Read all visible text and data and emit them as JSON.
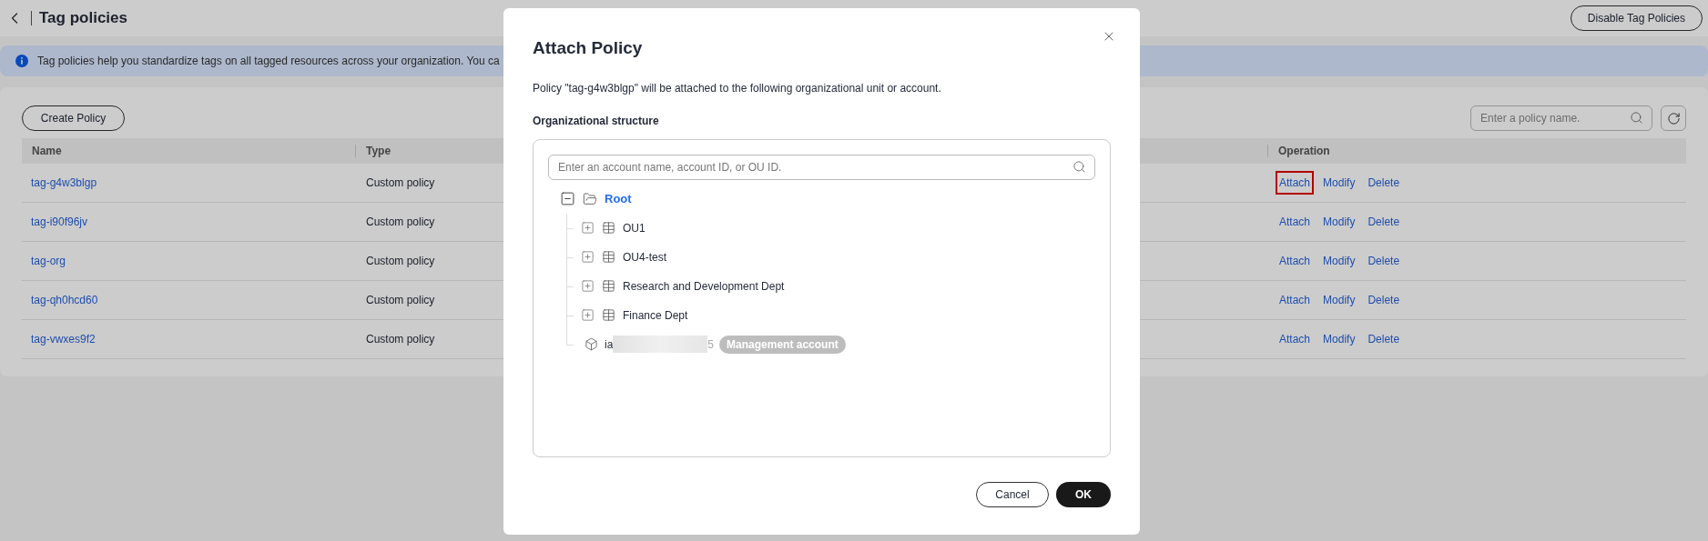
{
  "header": {
    "title": "Tag policies",
    "action": "Disable Tag Policies"
  },
  "banner": {
    "text": "Tag policies help you standardize tags on all tagged resources across your organization. You ca"
  },
  "toolbar": {
    "create": "Create Policy",
    "search": {
      "placeholder": "Enter a policy name."
    }
  },
  "table": {
    "columns": [
      "Name",
      "Type",
      "Operation"
    ],
    "rows": [
      {
        "name": "tag-g4w3blgp",
        "type": "Custom policy",
        "operations": [
          {
            "label": "Attach",
            "highlighted": true
          },
          {
            "label": "Modify",
            "highlighted": false
          },
          {
            "label": "Delete",
            "highlighted": false
          }
        ]
      },
      {
        "name": "tag-i90f96jv",
        "type": "Custom policy",
        "operations": [
          {
            "label": "Attach",
            "highlighted": false
          },
          {
            "label": "Modify",
            "highlighted": false
          },
          {
            "label": "Delete",
            "highlighted": false
          }
        ]
      },
      {
        "name": "tag-org",
        "type": "Custom policy",
        "operations": [
          {
            "label": "Attach",
            "highlighted": false
          },
          {
            "label": "Modify",
            "highlighted": false
          },
          {
            "label": "Delete",
            "highlighted": false
          }
        ]
      },
      {
        "name": "tag-qh0hcd60",
        "type": "Custom policy",
        "operations": [
          {
            "label": "Attach",
            "highlighted": false
          },
          {
            "label": "Modify",
            "highlighted": false
          },
          {
            "label": "Delete",
            "highlighted": false
          }
        ]
      },
      {
        "name": "tag-vwxes9f2",
        "type": "Custom policy",
        "operations": [
          {
            "label": "Attach",
            "highlighted": false
          },
          {
            "label": "Modify",
            "highlighted": false
          },
          {
            "label": "Delete",
            "highlighted": false
          }
        ]
      }
    ]
  },
  "dialog": {
    "title": "Attach Policy",
    "description": "Policy \"tag-g4w3blgp\" will be attached to the following organizational unit or account.",
    "section_label": "Organizational structure",
    "search": {
      "placeholder": "Enter an account name, account ID, or OU ID."
    },
    "tree": {
      "kind": "root",
      "label": "Root",
      "expanded": true,
      "children": [
        {
          "kind": "ou",
          "label": "OU1",
          "expanded": false
        },
        {
          "kind": "ou",
          "label": "OU4-test",
          "expanded": false
        },
        {
          "kind": "ou",
          "label": "Research and Development Dept",
          "expanded": false
        },
        {
          "kind": "ou",
          "label": "Finance Dept",
          "expanded": false
        },
        {
          "kind": "account",
          "label_start": "ia",
          "label_end": "5",
          "badge": "Management account"
        }
      ]
    },
    "buttons": [
      {
        "label": "Cancel",
        "kind": "secondary"
      },
      {
        "label": "OK",
        "kind": "primary"
      }
    ]
  }
}
